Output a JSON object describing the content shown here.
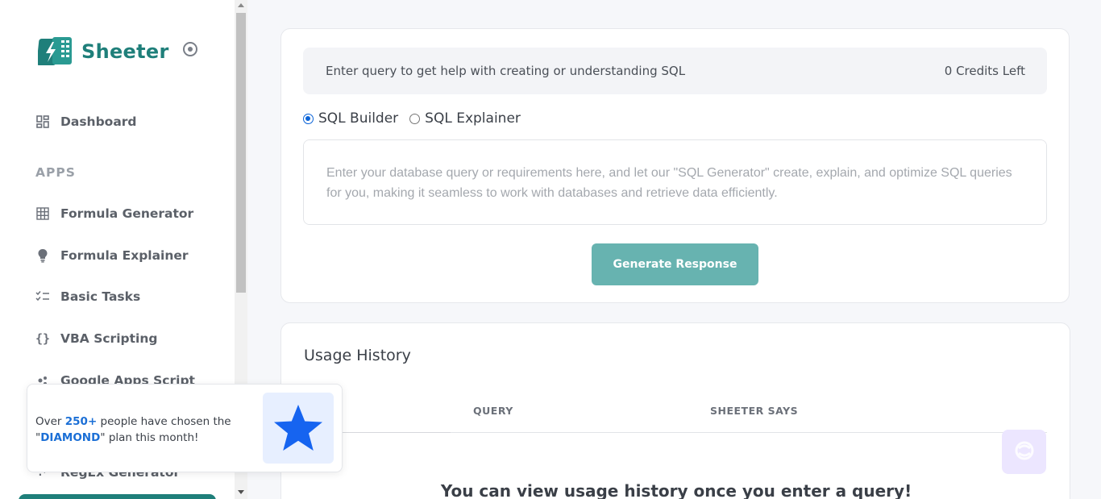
{
  "sidebar": {
    "brand_name": "Sheeter",
    "dashboard_label": "Dashboard",
    "section_label": "APPS",
    "items": [
      {
        "label": "Formula Generator",
        "icon": "table-grid-icon"
      },
      {
        "label": "Formula Explainer",
        "icon": "lightbulb-icon"
      },
      {
        "label": "Basic Tasks",
        "icon": "checklist-icon"
      },
      {
        "label": "VBA Scripting",
        "icon": "curly-braces-icon"
      },
      {
        "label": "Google Apps Script",
        "icon": "apps-script-icon"
      },
      {
        "label": "RegEx Generator",
        "icon": "regex-icon"
      }
    ]
  },
  "toast": {
    "prefix": "Over ",
    "count": "250+",
    "middle": " people have chosen the \"",
    "plan": "DIAMOND",
    "suffix": "\" plan this month!",
    "icon": "star-icon"
  },
  "query": {
    "banner_text": "Enter query to get help with creating or understanding SQL",
    "credits": "0 Credits Left",
    "modes": [
      {
        "label": "SQL Builder",
        "checked": true
      },
      {
        "label": "SQL Explainer",
        "checked": false
      }
    ],
    "placeholder": "Enter your database query or requirements here, and let our \"SQL Generator\" create, explain, and optimize SQL queries for you, making it seamless to work with databases and retrieve data efficiently.",
    "button_label": "Generate Response"
  },
  "history": {
    "title": "Usage History",
    "columns": [
      "QUERY",
      "SHEETER SAYS"
    ],
    "empty_message": "You can view usage history once you enter a query!"
  },
  "colors": {
    "brand": "#1f7f7a",
    "button": "#67b3b0",
    "accent_blue": "#1b6fd6"
  }
}
